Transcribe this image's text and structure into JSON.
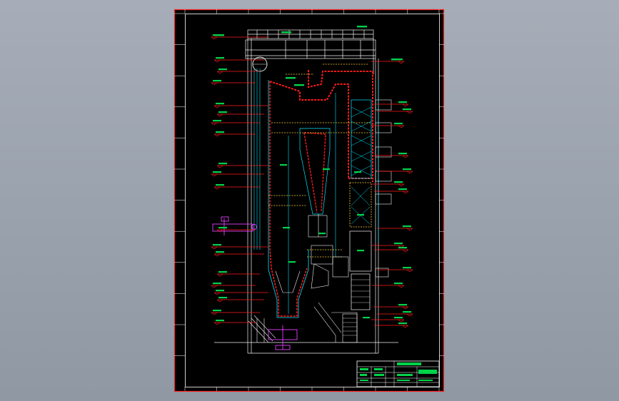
{
  "viewer": {
    "background_color": "#969ea9"
  },
  "drawing": {
    "sheet_color": "#000000",
    "border_color": "#ff2020",
    "frame_color": "#ffffff",
    "structure_color": "#f2f2f2",
    "cyan_color": "#00e5ff",
    "yellow_color": "#ffd23c",
    "red_color": "#ff1a1a",
    "green_color": "#00d24a",
    "magenta_color": "#e53dff",
    "title_block": {
      "cells": [
        "",
        "",
        "",
        "",
        "",
        "",
        "",
        ""
      ]
    }
  }
}
